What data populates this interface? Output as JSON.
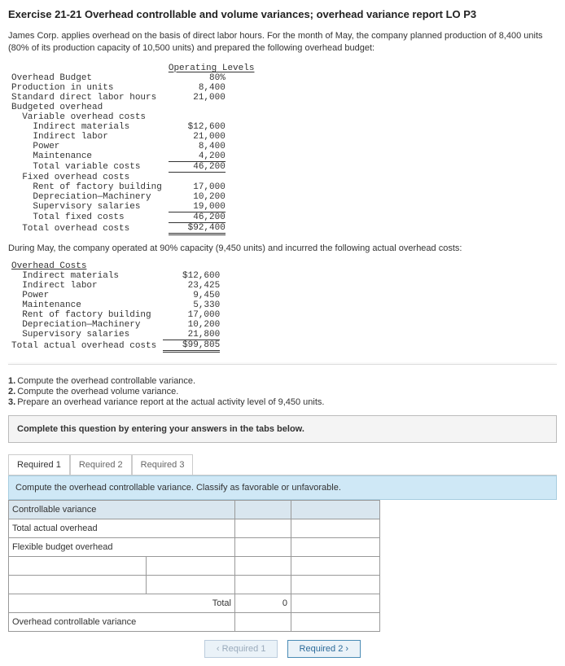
{
  "title": "Exercise 21-21 Overhead controllable and volume variances; overhead variance report LO P3",
  "intro": "James Corp. applies overhead on the basis of direct labor hours. For the month of May, the company planned production of 8,400 units (80% of its production capacity of 10,500 units) and prepared the following overhead budget:",
  "budget": {
    "col_header": "Operating Levels",
    "rows": {
      "overhead_budget": "Overhead Budget",
      "overhead_budget_val": "80%",
      "prod_units": "Production in units",
      "prod_units_val": "8,400",
      "std_dlh": "Standard direct labor hours",
      "std_dlh_val": "21,000",
      "budgeted_oh": "Budgeted overhead",
      "var_oh": "Variable overhead costs",
      "ind_mat": "Indirect materials",
      "ind_mat_val": "$12,600",
      "ind_lab": "Indirect labor",
      "ind_lab_val": "21,000",
      "power": "Power",
      "power_val": "8,400",
      "maint": "Maintenance",
      "maint_val": "4,200",
      "tot_var": "Total variable costs",
      "tot_var_val": "46,200",
      "fix_oh": "Fixed overhead costs",
      "rent": "Rent of factory building",
      "rent_val": "17,000",
      "dep": "Depreciation—Machinery",
      "dep_val": "10,200",
      "sup": "Supervisory salaries",
      "sup_val": "19,000",
      "tot_fix": "Total fixed costs",
      "tot_fix_val": "46,200",
      "tot_oh": "Total overhead costs",
      "tot_oh_val": "$92,400"
    }
  },
  "mid_text": "During May, the company operated at 90% capacity (9,450 units) and incurred the following actual overhead costs:",
  "actual": {
    "header": "Overhead Costs",
    "ind_mat": "Indirect materials",
    "ind_mat_val": "$12,600",
    "ind_lab": "Indirect labor",
    "ind_lab_val": "23,425",
    "power": "Power",
    "power_val": "9,450",
    "maint": "Maintenance",
    "maint_val": "5,330",
    "rent": "Rent of factory building",
    "rent_val": "17,000",
    "dep": "Depreciation—Machinery",
    "dep_val": "10,200",
    "sup": "Supervisory salaries",
    "sup_val": "21,800",
    "total": "Total actual overhead costs",
    "total_val": "$99,805"
  },
  "questions": {
    "q1n": "1.",
    "q1": "Compute the overhead controllable variance.",
    "q2n": "2.",
    "q2": "Compute the overhead volume variance.",
    "q3n": "3.",
    "q3": "Prepare an overhead variance report at the actual activity level of 9,450 units."
  },
  "panel_text": "Complete this question by entering your answers in the tabs below.",
  "tabs": {
    "t1": "Required 1",
    "t2": "Required 2",
    "t3": "Required 3"
  },
  "bluebar": "Compute the overhead controllable variance. Classify as favorable or unfavorable.",
  "work": {
    "hdr": "Controllable variance",
    "r1": "Total actual overhead",
    "r2": "Flexible budget overhead",
    "r3": "",
    "r4": "",
    "total": "Total",
    "total_val": "0",
    "ocv": "Overhead controllable variance"
  },
  "nav": {
    "prev": "‹  Required 1",
    "next": "Required 2  ›"
  }
}
